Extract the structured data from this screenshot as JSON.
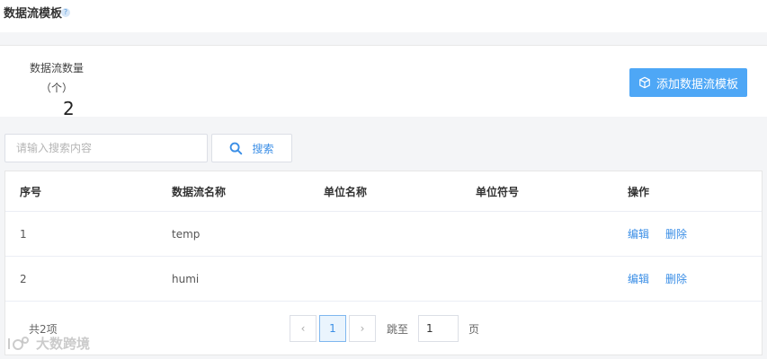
{
  "header": {
    "title": "数据流模板",
    "help_glyph": "?"
  },
  "summary": {
    "stat_label": "数据流数量",
    "stat_unit": "（个）",
    "stat_value": "2",
    "add_button_label": "添加数据流模板"
  },
  "search": {
    "placeholder": "请输入搜索内容",
    "button_label": "搜索"
  },
  "table": {
    "columns": [
      "序号",
      "数据流名称",
      "单位名称",
      "单位符号",
      "操作"
    ],
    "rows": [
      {
        "index": "1",
        "name": "temp",
        "unit_name": "",
        "unit_symbol": "",
        "edit": "编辑",
        "delete": "删除"
      },
      {
        "index": "2",
        "name": "humi",
        "unit_name": "",
        "unit_symbol": "",
        "edit": "编辑",
        "delete": "删除"
      }
    ]
  },
  "pagination": {
    "total_text": "共2项",
    "prev_glyph": "‹",
    "current_page": "1",
    "next_glyph": "›",
    "jump_label": "跳至",
    "jump_value": "1",
    "page_label": "页"
  },
  "watermark": {
    "text": "大数跨境"
  },
  "colors": {
    "accent": "#4ea7f6",
    "link": "#3a8ee6",
    "background": "#f4f5f7"
  }
}
